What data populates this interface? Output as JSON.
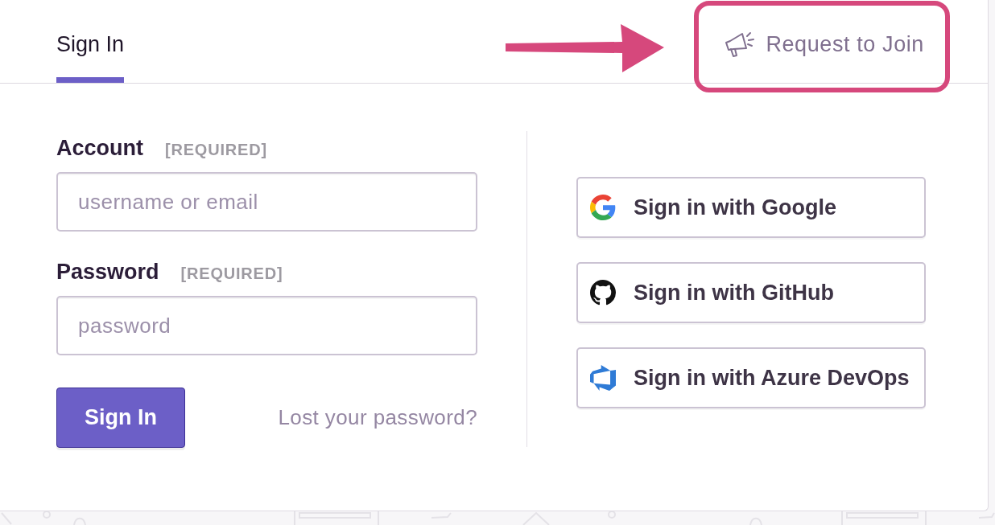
{
  "tabs": [
    {
      "label": "Sign In",
      "selected": true
    }
  ],
  "request_link": {
    "label": "Request to Join"
  },
  "form": {
    "fields": [
      {
        "label": "Account",
        "note": "[REQUIRED]",
        "placeholder": "username or email"
      },
      {
        "label": "Password",
        "note": "[REQUIRED]",
        "placeholder": "password"
      }
    ],
    "submit": "Sign In",
    "forgot_link": "Lost your password?"
  },
  "providers": [
    {
      "kind": "google",
      "label": "Sign in with Google"
    },
    {
      "kind": "github",
      "label": "Sign in with GitHub"
    },
    {
      "kind": "azure",
      "label": "Sign in with Azure DevOps"
    }
  ],
  "annotation": {
    "arrow": true,
    "frame": true
  }
}
